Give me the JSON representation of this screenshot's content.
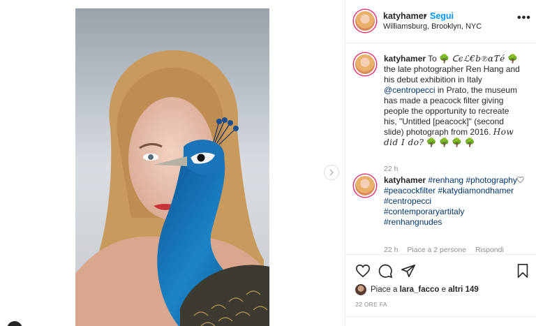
{
  "post": {
    "username": "katyhamer",
    "separator": "•",
    "follow_label": "Segui",
    "location": "Williamsburg, Brooklyn, NYC",
    "more_label": "•••"
  },
  "caption": {
    "username": "katyhamer",
    "part1": "To",
    "celebrate": "ᑕєℒ€b℗αƬé",
    "part2": "the late photographer Ren Hang and his debut exhibition in Italy",
    "mention": "@centropecci",
    "part3": "in Prato, the museum has made a peacock filter giving people the opportunity to recreate his, \"Untitled [peacock]\" (second slide) photograph from 2016.",
    "how": "How did I do?",
    "tree_glyph": "🌳",
    "time": "22 h"
  },
  "comment": {
    "username": "katyhamer",
    "tags": [
      "#renhang",
      "#photography",
      "#peacockfilter",
      "#katydiamondhamer",
      "#centropecci",
      "#contemporaryartitaly",
      "#renhangnudes"
    ],
    "time": "22 h",
    "likes": "Piace a 2 persone",
    "reply": "Rispondi"
  },
  "actions": {
    "liked_by_prefix": "Piace a",
    "liked_by_user": "lara_facco",
    "liked_by_join": "e",
    "liked_by_others": "altri 149",
    "timestamp": "22 ORE FA"
  },
  "colors": {
    "accent": "#0095f6",
    "link": "#00376b",
    "muted": "#8e8e8e",
    "text": "#262626"
  },
  "icons": [
    "heart-icon",
    "comment-icon",
    "share-icon",
    "bookmark-icon",
    "chevron-right-icon",
    "more-icon"
  ]
}
